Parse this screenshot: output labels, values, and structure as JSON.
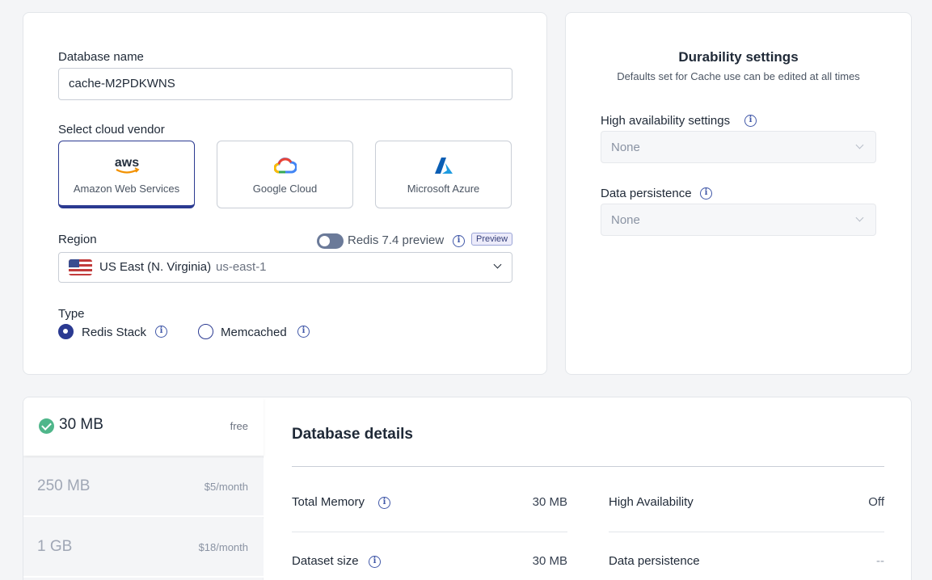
{
  "config": {
    "db_name_label": "Database name",
    "db_name_value": "cache-M2PDKWNS",
    "vendor_label": "Select cloud vendor",
    "vendors": [
      {
        "name": "Amazon Web Services",
        "icon": "aws-logo-icon",
        "selected": true
      },
      {
        "name": "Google Cloud",
        "icon": "google-cloud-logo-icon",
        "selected": false
      },
      {
        "name": "Microsoft Azure",
        "icon": "azure-logo-icon",
        "selected": false
      }
    ],
    "aws_logo_text": "aws",
    "region_label": "Region",
    "preview_toggle_label": "Redis 7.4 preview",
    "preview_badge": "Preview",
    "region_name": "US East (N. Virginia)",
    "region_code": "us-east-1",
    "type_label": "Type",
    "types": [
      {
        "label": "Redis Stack",
        "selected": true
      },
      {
        "label": "Memcached",
        "selected": false
      }
    ]
  },
  "durability": {
    "title": "Durability settings",
    "subtitle": "Defaults set for Cache use can be edited at all times",
    "ha_label": "High availability settings",
    "ha_value": "None",
    "persistence_label": "Data persistence",
    "persistence_value": "None"
  },
  "plans": [
    {
      "size": "30 MB",
      "price": "free",
      "selected": true
    },
    {
      "size": "250 MB",
      "price": "$5/month",
      "selected": false
    },
    {
      "size": "1 GB",
      "price": "$18/month",
      "selected": false
    }
  ],
  "details": {
    "title": "Database details",
    "rows": [
      {
        "label": "Total Memory",
        "value": "30 MB"
      },
      {
        "label": "High Availability",
        "value": "Off"
      },
      {
        "label": "Dataset size",
        "value": "30 MB"
      },
      {
        "label": "Data persistence",
        "value": "--"
      }
    ]
  },
  "colors": {
    "accent": "#2b3a91",
    "success": "#4fb68a",
    "background": "#f4f5f7"
  }
}
